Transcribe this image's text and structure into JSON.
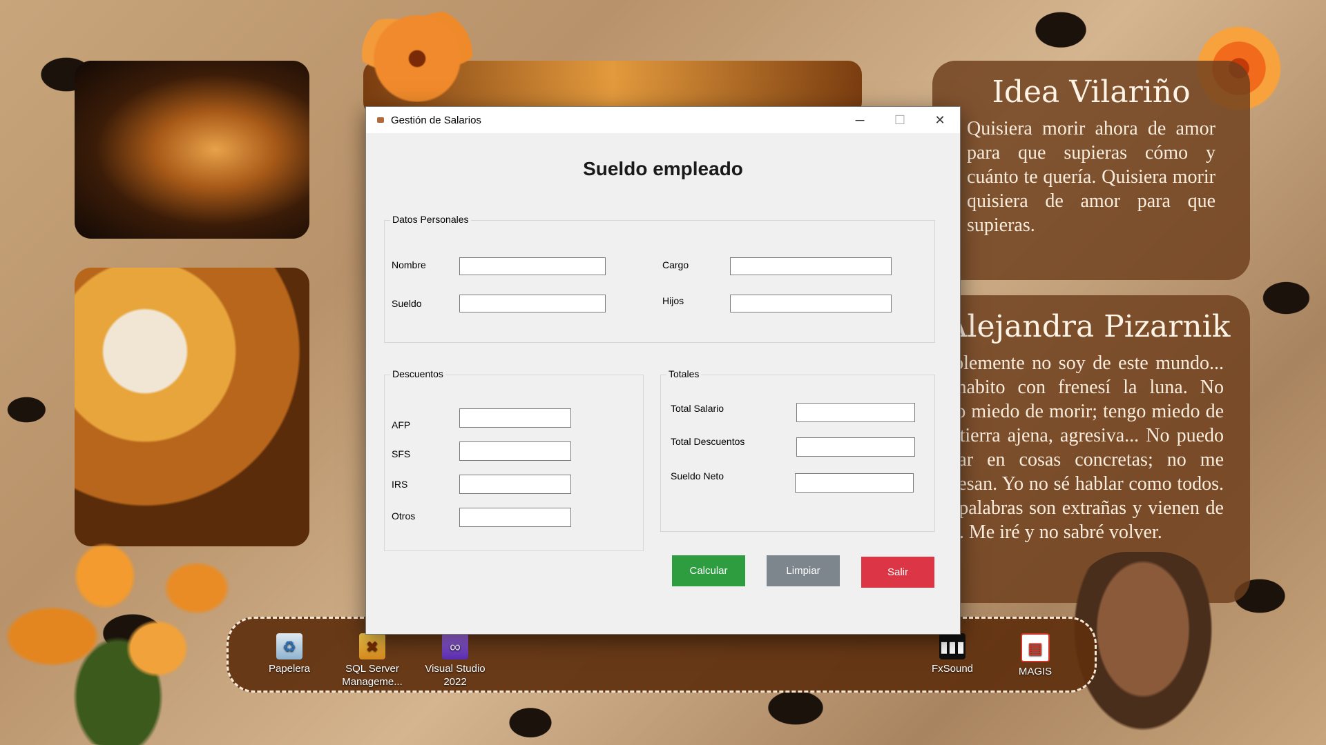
{
  "desktop": {
    "quotes": [
      {
        "title": "Idea Vilariño",
        "text": "Quisiera morir ahora de amor para que supieras cómo y cuánto te quería. Quisiera morir quisiera de amor para que supieras."
      },
      {
        "title": "Alejandra Pizarnik",
        "text": "Simplemente no soy de este mundo... Yo habito con frenesí la luna. No tengo miedo de morir; tengo miedo de esta tierra ajena, agresiva... No puedo pensar en cosas concretas; no me interesan. Yo no sé hablar como todos. Mis palabras son extrañas y vienen de lejos. Me iré y no sabré volver."
      }
    ],
    "icons": [
      {
        "label": "Papelera",
        "icon": "recycle-bin-icon"
      },
      {
        "label": "SQL Server Manageme...",
        "icon": "sql-server-icon"
      },
      {
        "label": "Visual Studio 2022",
        "icon": "visual-studio-icon"
      },
      {
        "label": "FxSound",
        "icon": "fxsound-icon"
      },
      {
        "label": "MAGIS",
        "icon": "magis-icon"
      }
    ]
  },
  "window": {
    "title": "Gestión de Salarios",
    "heading": "Sueldo empleado",
    "personal": {
      "legend": "Datos Personales",
      "nombre_label": "Nombre",
      "cargo_label": "Cargo",
      "sueldo_label": "Sueldo",
      "hijos_label": "Hijos"
    },
    "descuentos": {
      "legend": "Descuentos",
      "afp_label": "AFP",
      "sfs_label": "SFS",
      "irs_label": "IRS",
      "otros_label": "Otros"
    },
    "totales": {
      "legend": "Totales",
      "total_salario_label": "Total Salario",
      "total_descuentos_label": "Total Descuentos",
      "sueldo_neto_label": "Sueldo Neto"
    },
    "buttons": {
      "calcular": "Calcular",
      "limpiar": "Limpiar",
      "salir": "Salir"
    },
    "colors": {
      "calcular": "#2d9d3f",
      "limpiar": "#7d858d",
      "salir": "#dc3545"
    }
  }
}
